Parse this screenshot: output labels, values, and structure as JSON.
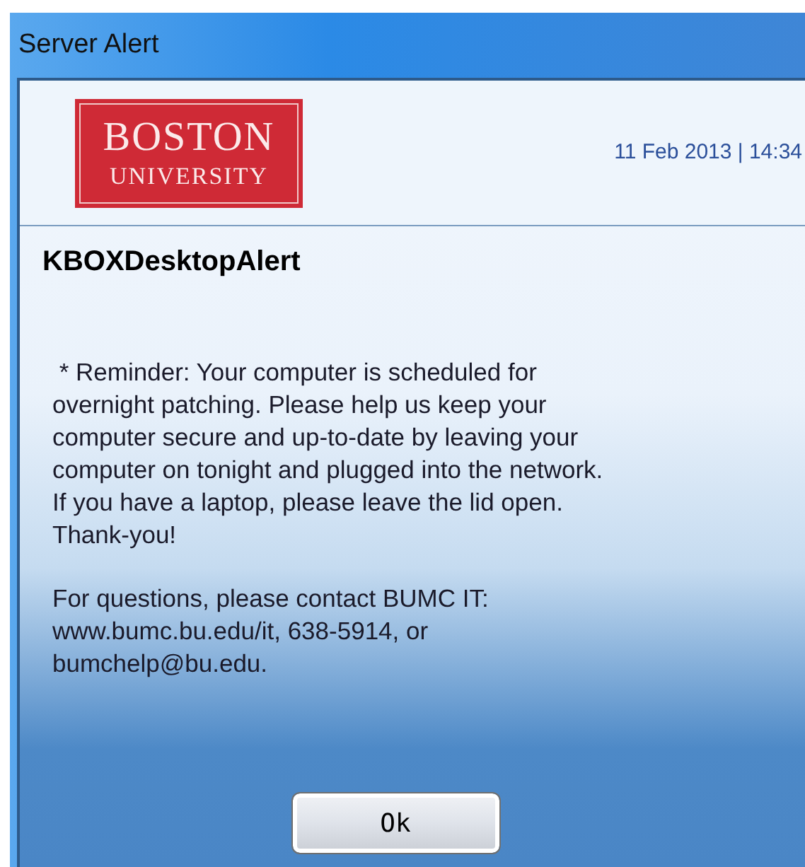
{
  "window": {
    "title": "Server Alert"
  },
  "logo": {
    "line_1": "BOSTON",
    "line_2": "UNIVERSITY"
  },
  "timestamp": "11 Feb 2013 | 14:34",
  "alert_title": "KBOXDesktopAlert",
  "paragraphs": [
    " * Reminder: Your computer is scheduled for\novernight patching. Please help us keep your\ncomputer secure and up-to-date by leaving your\ncomputer on tonight and plugged into the network.\nIf you have a laptop, please leave the lid open.\nThank-you!",
    "For questions, please contact BUMC IT:\nwww.bumc.bu.edu/it, 638-5914, or\nbumchelp@bu.edu."
  ],
  "buttons": [
    "Ok"
  ]
}
